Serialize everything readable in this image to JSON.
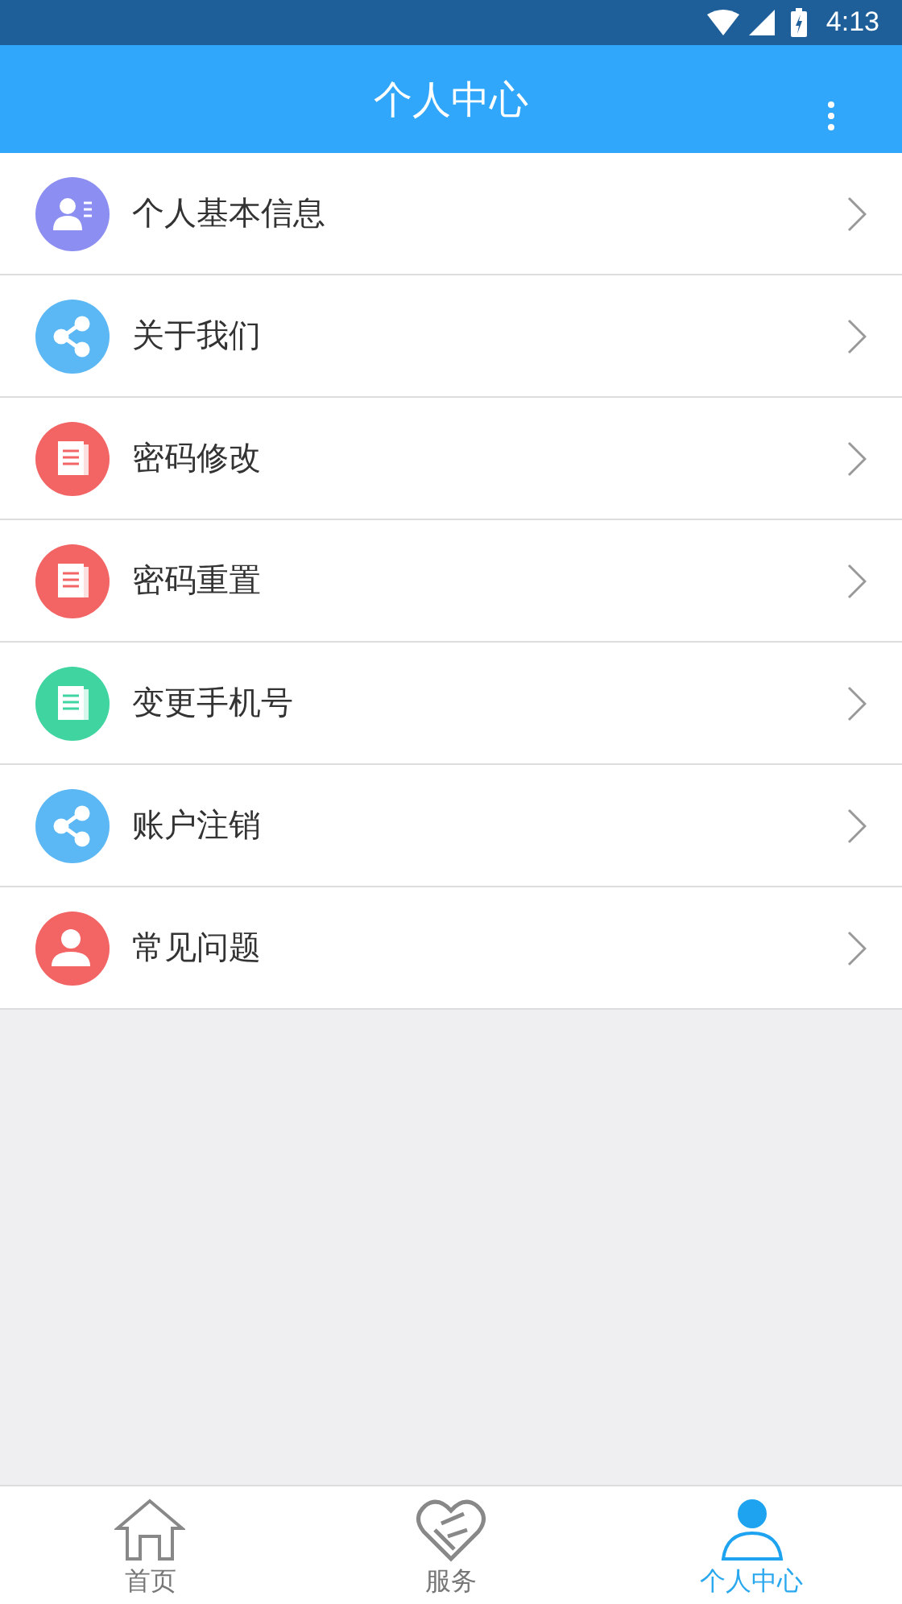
{
  "status_bar": {
    "time": "4:13"
  },
  "app_bar": {
    "title": "个人中心"
  },
  "menu_items": [
    {
      "label": "个人基本信息",
      "kind": "profile",
      "color": "#8c8ef2"
    },
    {
      "label": "关于我们",
      "kind": "share",
      "color": "#5bb8f5"
    },
    {
      "label": "密码修改",
      "kind": "document",
      "color": "#f36464"
    },
    {
      "label": "密码重置",
      "kind": "document",
      "color": "#f36464"
    },
    {
      "label": "变更手机号",
      "kind": "document",
      "color": "#3fd4a0"
    },
    {
      "label": "账户注销",
      "kind": "share",
      "color": "#5bb8f5"
    },
    {
      "label": "常见问题",
      "kind": "user",
      "color": "#f36464"
    }
  ],
  "tabs": [
    {
      "label": "首页",
      "kind": "home",
      "selected": false
    },
    {
      "label": "服务",
      "kind": "handshake",
      "selected": false
    },
    {
      "label": "个人中心",
      "kind": "person",
      "selected": true
    }
  ]
}
